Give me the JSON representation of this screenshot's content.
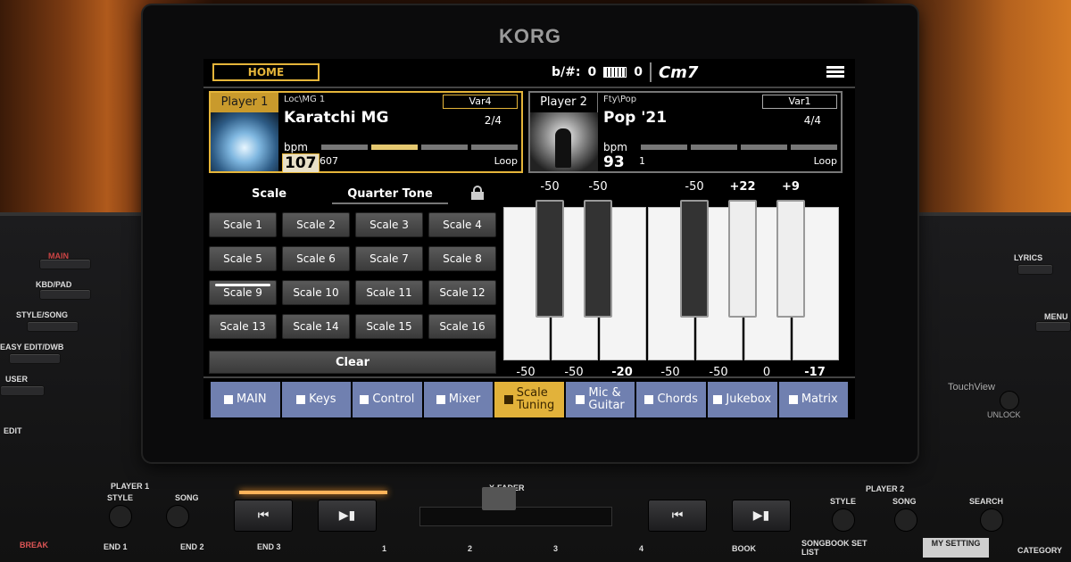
{
  "brand": "KORG",
  "topbar": {
    "home_label": "HOME",
    "accidental_label": "b/#:",
    "accidental_value": "0",
    "transpose_value": "0",
    "chord": "Cm7"
  },
  "player1": {
    "label": "Player 1",
    "path": "Loc\\MG 1",
    "variation": "Var4",
    "name": "Karatchi MG",
    "count": "2/4",
    "bpm_label": "bpm",
    "bpm": "107",
    "measures": "607",
    "mode": "Loop",
    "progress_active_index": 1
  },
  "player2": {
    "label": "Player 2",
    "path": "Fty\\Pop",
    "variation": "Var1",
    "name": "Pop '21",
    "count": "4/4",
    "bpm_label": "bpm",
    "bpm": "93",
    "measures": "1",
    "mode": "Loop"
  },
  "scale_panel": {
    "tab_scale": "Scale",
    "tab_quarter": "Quarter Tone",
    "buttons": [
      "Scale 1",
      "Scale  2",
      "Scale 3",
      "Scale 4",
      "Scale 5",
      "Scale 6",
      "Scale 7",
      "Scale 8",
      "Scale 9",
      "Scale 10",
      "Scale 11",
      "Scale 12",
      "Scale 13",
      "Scale 14",
      "Scale 15",
      "Scale 16"
    ],
    "active_button": "Scale 9",
    "clear_label": "Clear"
  },
  "tuning": {
    "black_keys": [
      "-50",
      "-50",
      "-50",
      "+22",
      "+9"
    ],
    "white_keys": [
      "-50",
      "-50",
      "-20",
      "-50",
      "-50",
      "0",
      "-17"
    ]
  },
  "bottom_tabs": [
    "MAIN",
    "Keys",
    "Control",
    "Mixer",
    "Scale\nTuning",
    "Mic &\nGuitar",
    "Chords",
    "Jukebox",
    "Matrix"
  ],
  "active_tab": "Scale\nTuning",
  "hardware": {
    "left_buttons": [
      "MAIN",
      "KBD/PAD",
      "STYLE/SONG",
      "EASY EDIT/DWB",
      "USER",
      "EDIT"
    ],
    "player1_label": "PLAYER 1",
    "player1_style": "STYLE",
    "player1_song": "SONG",
    "player2_label": "PLAYER 2",
    "player2_style": "STYLE",
    "player2_song": "SONG",
    "xfader_label": "X-FADER",
    "search_label": "SEARCH",
    "bottom_labels": [
      "BREAK",
      "END 1",
      "END 2",
      "END 3",
      "1",
      "2",
      "3",
      "4",
      "BOOK",
      "SONGBOOK SET LIST",
      "CATEGORY"
    ],
    "my_setting": "MY SETTING",
    "touchview": "TouchView",
    "unlock": "UNLOCK",
    "right_labels": [
      "LYRICS",
      "MENU"
    ]
  }
}
